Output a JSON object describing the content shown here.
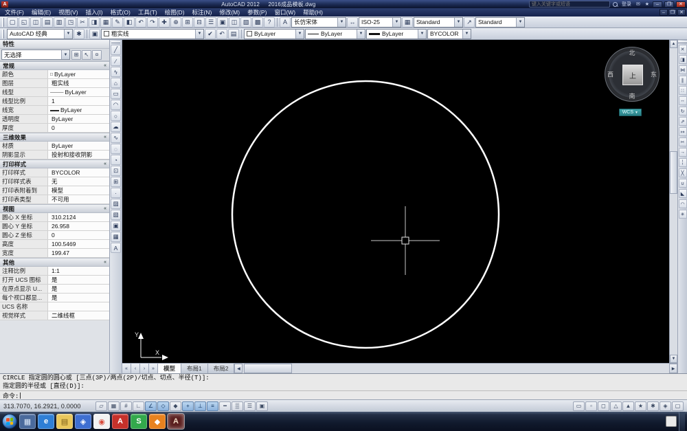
{
  "titlebar": {
    "app_title": "AutoCAD 2012",
    "doc_title": "2016成品模板.dwg",
    "search_placeholder": "键入关键字或短语",
    "signin_label": "登录",
    "buttons": {
      "minimize": "–",
      "restore": "❐",
      "close": "✕"
    }
  },
  "menubar": {
    "items": [
      "文件(F)",
      "编辑(E)",
      "视图(V)",
      "插入(I)",
      "格式(O)",
      "工具(T)",
      "绘图(D)",
      "标注(N)",
      "修改(M)",
      "参数(P)",
      "窗口(W)",
      "帮助(H)"
    ],
    "win_buttons": {
      "minimize": "–",
      "restore": "❐",
      "close": "✕"
    }
  },
  "toolbar1": {
    "icons": [
      {
        "name": "new-file-icon",
        "glyph": "▢"
      },
      {
        "name": "open-file-icon",
        "glyph": "◱"
      },
      {
        "name": "save-icon",
        "glyph": "◫"
      },
      {
        "name": "plot-icon",
        "glyph": "▤"
      },
      {
        "name": "plot-preview-icon",
        "glyph": "▥"
      },
      {
        "name": "publish-icon",
        "glyph": "◳"
      },
      {
        "name": "cut-icon",
        "glyph": "✂"
      },
      {
        "name": "copy-icon",
        "glyph": "◨"
      },
      {
        "name": "paste-icon",
        "glyph": "▦"
      },
      {
        "name": "match-properties-icon",
        "glyph": "✎"
      },
      {
        "name": "block-editor-icon",
        "glyph": "◧"
      },
      {
        "name": "undo-icon",
        "glyph": "↶"
      },
      {
        "name": "redo-icon",
        "glyph": "↷"
      },
      {
        "name": "pan-icon",
        "glyph": "✚"
      },
      {
        "name": "zoom-realtime-icon",
        "glyph": "⊕"
      },
      {
        "name": "zoom-window-icon",
        "glyph": "⊞"
      },
      {
        "name": "zoom-previous-icon",
        "glyph": "⊟"
      },
      {
        "name": "properties-icon",
        "glyph": "☰"
      },
      {
        "name": "designcenter-icon",
        "glyph": "▣"
      },
      {
        "name": "tool-palettes-icon",
        "glyph": "◫"
      },
      {
        "name": "sheet-set-manager-icon",
        "glyph": "▧"
      },
      {
        "name": "quickcalc-icon",
        "glyph": "▩"
      },
      {
        "name": "help-icon",
        "glyph": "?"
      }
    ],
    "style_tool_icons": {
      "text_glyph": "A",
      "dim_glyph": "↔",
      "table_glyph": "▦",
      "mleader_glyph": "↗"
    },
    "text_style": "长仿宋体",
    "dim_style": "ISO-25",
    "table_style": "Standard",
    "mleader_style": "Standard"
  },
  "toolbar2": {
    "workspace": "AutoCAD 经典",
    "pre_icons": [
      {
        "name": "workspace-settings-icon",
        "glyph": "✱"
      }
    ],
    "layer_icons": [
      {
        "name": "layer-properties-icon",
        "glyph": "▣"
      }
    ],
    "layer_name": "粗实线",
    "layer_after_icons": [
      {
        "name": "make-layer-current-icon",
        "glyph": "✔"
      },
      {
        "name": "layer-previous-icon",
        "glyph": "↶"
      },
      {
        "name": "layer-states-icon",
        "glyph": "▤"
      }
    ],
    "color": "ByLayer",
    "linetype": "ByLayer",
    "lineweight": "ByLayer",
    "plot_style": "BYCOLOR"
  },
  "palette": {
    "title": "特性",
    "selector": "无选择",
    "header_buttons": [
      {
        "name": "pickadd-toggle-icon",
        "glyph": "⊞"
      },
      {
        "name": "select-objects-icon",
        "glyph": "↖"
      },
      {
        "name": "quick-select-icon",
        "glyph": "¤"
      }
    ],
    "sec_general": {
      "header": "常规",
      "rows": [
        {
          "label": "颜色",
          "prefix": "□",
          "value": "ByLayer"
        },
        {
          "label": "图层",
          "prefix": "",
          "value": "粗实线"
        },
        {
          "label": "线型",
          "prefix": "———",
          "value": "ByLayer"
        },
        {
          "label": "线型比例",
          "prefix": "",
          "value": "1"
        },
        {
          "label": "线宽",
          "prefix": "▬▬",
          "value": "ByLayer"
        },
        {
          "label": "透明度",
          "prefix": "",
          "value": "ByLayer"
        },
        {
          "label": "厚度",
          "prefix": "",
          "value": "0"
        }
      ]
    },
    "sec_3d": {
      "header": "三维效果",
      "rows": [
        {
          "label": "材质",
          "prefix": "",
          "value": "ByLayer"
        },
        {
          "label": "阴影显示",
          "prefix": "",
          "value": "投射和接收阴影"
        }
      ]
    },
    "sec_plot": {
      "header": "打印样式",
      "rows": [
        {
          "label": "打印样式",
          "prefix": "",
          "value": "BYCOLOR"
        },
        {
          "label": "打印样式表",
          "prefix": "",
          "value": "无"
        },
        {
          "label": "打印表附着到",
          "prefix": "",
          "value": "模型"
        },
        {
          "label": "打印表类型",
          "prefix": "",
          "value": "不可用"
        }
      ]
    },
    "sec_view": {
      "header": "视图",
      "rows": [
        {
          "label": "圆心 X 坐标",
          "prefix": "",
          "value": "310.2124"
        },
        {
          "label": "圆心 Y 坐标",
          "prefix": "",
          "value": "26.958"
        },
        {
          "label": "圆心 Z 坐标",
          "prefix": "",
          "value": "0"
        },
        {
          "label": "高度",
          "prefix": "",
          "value": "100.5469"
        },
        {
          "label": "宽度",
          "prefix": "",
          "value": "199.47"
        }
      ]
    },
    "sec_misc": {
      "header": "其他",
      "rows": [
        {
          "label": "注释比例",
          "prefix": "",
          "value": "1:1"
        },
        {
          "label": "打开 UCS 图标",
          "prefix": "",
          "value": "是"
        },
        {
          "label": "在原点显示 U...",
          "prefix": "",
          "value": "是"
        },
        {
          "label": "每个视口都显...",
          "prefix": "",
          "value": "是"
        },
        {
          "label": "UCS 名称",
          "prefix": "",
          "value": ""
        },
        {
          "label": "视觉样式",
          "prefix": "",
          "value": "二维线框"
        }
      ]
    }
  },
  "draw_toolbar": {
    "icons": [
      {
        "name": "line-icon",
        "glyph": "╱"
      },
      {
        "name": "construction-line-icon",
        "glyph": "∕"
      },
      {
        "name": "polyline-icon",
        "glyph": "ϟ"
      },
      {
        "name": "polygon-icon",
        "glyph": "⌂"
      },
      {
        "name": "rectangle-icon",
        "glyph": "▭"
      },
      {
        "name": "arc-icon",
        "glyph": "◠"
      },
      {
        "name": "circle-icon",
        "glyph": "○"
      },
      {
        "name": "revision-cloud-icon",
        "glyph": "☁"
      },
      {
        "name": "spline-icon",
        "glyph": "∿"
      },
      {
        "name": "ellipse-icon",
        "glyph": "◌"
      },
      {
        "name": "ellipse-arc-icon",
        "glyph": "◔"
      },
      {
        "name": "insert-block-icon",
        "glyph": "⊡"
      },
      {
        "name": "make-block-icon",
        "glyph": "⊞"
      },
      {
        "name": "point-icon",
        "glyph": "·"
      },
      {
        "name": "hatch-icon",
        "glyph": "▨"
      },
      {
        "name": "gradient-icon",
        "glyph": "▧"
      },
      {
        "name": "region-icon",
        "glyph": "▣"
      },
      {
        "name": "table-icon",
        "glyph": "▦"
      },
      {
        "name": "mtext-icon",
        "glyph": "A"
      }
    ]
  },
  "modify_toolbar": {
    "icons": [
      {
        "name": "erase-icon",
        "glyph": "✕"
      },
      {
        "name": "copy-object-icon",
        "glyph": "◨"
      },
      {
        "name": "mirror-icon",
        "glyph": "⋈"
      },
      {
        "name": "offset-icon",
        "glyph": "∥"
      },
      {
        "name": "array-icon",
        "glyph": "∷"
      },
      {
        "name": "move-icon",
        "glyph": "↔"
      },
      {
        "name": "rotate-icon",
        "glyph": "↻"
      },
      {
        "name": "scale-icon",
        "glyph": "⇗"
      },
      {
        "name": "stretch-icon",
        "glyph": "↦"
      },
      {
        "name": "trim-icon",
        "glyph": "✂"
      },
      {
        "name": "extend-icon",
        "glyph": "→"
      },
      {
        "name": "break-at-point-icon",
        "glyph": "¦"
      },
      {
        "name": "break-icon",
        "glyph": "╳"
      },
      {
        "name": "join-icon",
        "glyph": "∪"
      },
      {
        "name": "chamfer-icon",
        "glyph": "◣"
      },
      {
        "name": "fillet-icon",
        "glyph": "◠"
      },
      {
        "name": "explode-icon",
        "glyph": "✳"
      }
    ]
  },
  "drawing": {
    "viewcube": {
      "north": "北",
      "south": "南",
      "west": "西",
      "east": "东",
      "top": "上",
      "wcs_label": "WCS"
    },
    "ucs": {
      "x_label": "X",
      "y_label": "Y"
    },
    "tab_nav": [
      "«",
      "‹",
      "›",
      "»"
    ],
    "tabs": [
      {
        "name": "tab-model",
        "label": "模型",
        "active": true
      },
      {
        "name": "tab-layout1",
        "label": "布局1"
      },
      {
        "name": "tab-layout2",
        "label": "布局2"
      }
    ]
  },
  "scrollbars": {
    "up": "▲",
    "down": "▼",
    "left": "◀",
    "right": "▶"
  },
  "command": {
    "history": [
      "CIRCLE 指定圆的圆心或 [三点(3P)/两点(2P)/切点、切点、半径(T)]:",
      "指定圆的半径或 [直径(D)]:"
    ],
    "prompt": "命令:"
  },
  "statusbar": {
    "coords": "313.7070, 16.2921, 0.0000",
    "toggles": [
      {
        "name": "infer-constraints-toggle",
        "glyph": "▱",
        "on": false
      },
      {
        "name": "snap-mode-toggle",
        "glyph": "▦",
        "on": false
      },
      {
        "name": "grid-display-toggle",
        "glyph": "#",
        "on": false
      },
      {
        "name": "ortho-mode-toggle",
        "glyph": "∟",
        "on": false
      },
      {
        "name": "polar-tracking-toggle",
        "glyph": "∠",
        "on": true
      },
      {
        "name": "object-snap-toggle",
        "glyph": "◇",
        "on": true
      },
      {
        "name": "3d-object-snap-toggle",
        "glyph": "◆",
        "on": false
      },
      {
        "name": "object-snap-tracking-toggle",
        "glyph": "+",
        "on": true
      },
      {
        "name": "dynamic-ucs-toggle",
        "glyph": "⊥",
        "on": true
      },
      {
        "name": "dynamic-input-toggle",
        "glyph": "≡",
        "on": true
      },
      {
        "name": "lineweight-display-toggle",
        "glyph": "━",
        "on": false
      },
      {
        "name": "transparency-toggle",
        "glyph": "▒",
        "on": false
      },
      {
        "name": "quick-properties-toggle",
        "glyph": "☰",
        "on": false
      },
      {
        "name": "selection-cycling-toggle",
        "glyph": "▣",
        "on": false
      }
    ],
    "right_icons": [
      {
        "name": "model-space-button",
        "glyph": "▭"
      },
      {
        "name": "quick-view-layouts-button",
        "glyph": "▫"
      },
      {
        "name": "quick-view-drawings-button",
        "glyph": "◻"
      },
      {
        "name": "annotation-scale-button",
        "glyph": "△"
      },
      {
        "name": "annotation-visibility-button",
        "glyph": "▲"
      },
      {
        "name": "auto-annotation-scale-button",
        "glyph": "★"
      },
      {
        "name": "workspace-switching-button",
        "glyph": "✱"
      },
      {
        "name": "toolbar-lock-button",
        "glyph": "◈"
      },
      {
        "name": "clean-screen-button",
        "glyph": "▢"
      }
    ]
  },
  "taskbar": {
    "items": [
      {
        "name": "taskbar-desktop-icon",
        "glyph": "▦",
        "bg": "#4a6a9c",
        "fg": "#dce8f8"
      },
      {
        "name": "taskbar-ie-icon",
        "glyph": "e",
        "bg": "#2f7fd6",
        "fg": "#ffffff"
      },
      {
        "name": "taskbar-folder-icon",
        "glyph": "▤",
        "bg": "#e9c75c",
        "fg": "#7a5c16"
      },
      {
        "name": "taskbar-media-player-icon",
        "glyph": "◈",
        "bg": "#3f6fd1",
        "fg": "#ffffff"
      },
      {
        "name": "taskbar-chrome-icon",
        "glyph": "◉",
        "bg": "#f2f2f2",
        "fg": "#d84b3c"
      },
      {
        "name": "taskbar-adobe-reader-icon",
        "glyph": "A",
        "bg": "#c6312b",
        "fg": "#ffffff"
      },
      {
        "name": "taskbar-sogou-icon",
        "glyph": "S",
        "bg": "#33a94c",
        "fg": "#ffffff"
      },
      {
        "name": "taskbar-office-icon",
        "glyph": "◆",
        "bg": "#e8821f",
        "fg": "#ffffff"
      },
      {
        "name": "taskbar-autocad-icon",
        "glyph": "A",
        "bg": "#5a1f1f",
        "fg": "#f0d9c2",
        "active": true
      }
    ]
  }
}
